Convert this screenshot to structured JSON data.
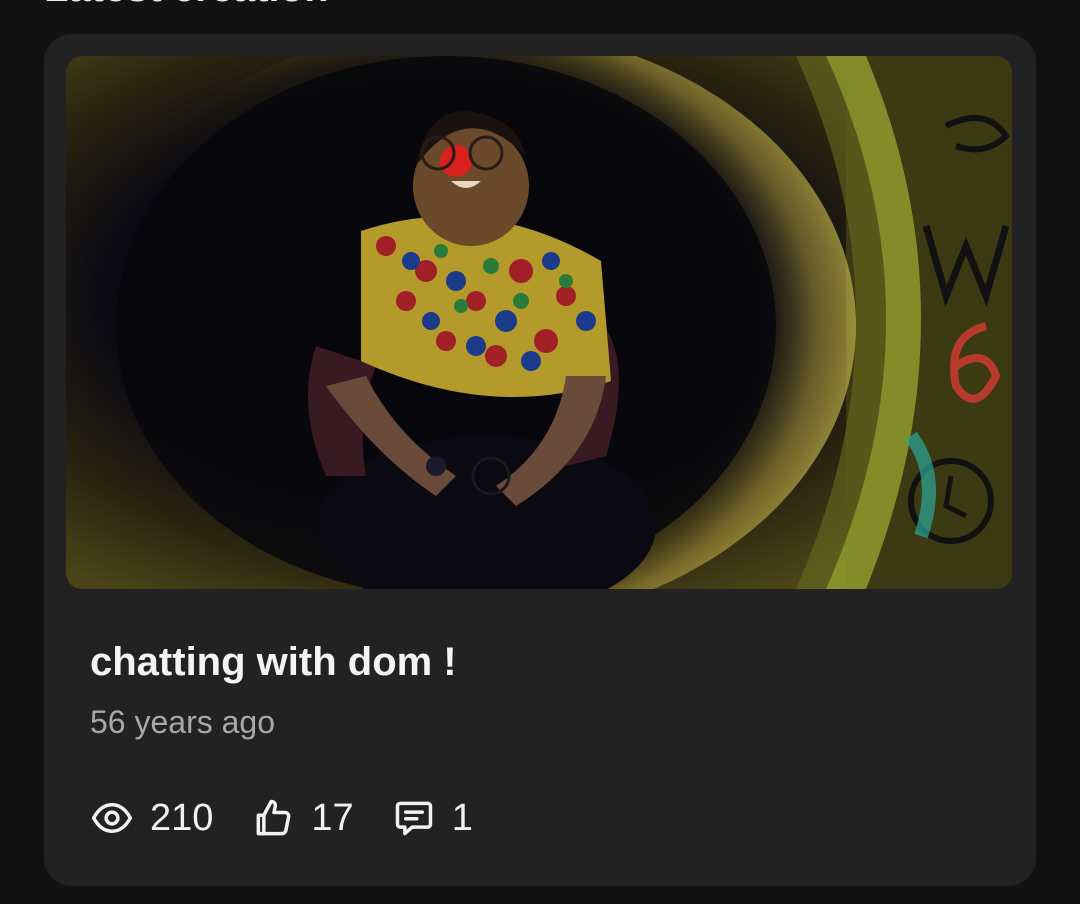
{
  "section": {
    "heading": "Latest creation"
  },
  "video": {
    "title": "chatting with dom !",
    "date": "56 years ago",
    "thumbnail_icon": "video-thumbnail-clown-in-tunnel",
    "stats": {
      "views": "210",
      "likes": "17",
      "comments": "1"
    },
    "icons": {
      "views": "eye-icon",
      "likes": "thumbs-up-icon",
      "comments": "comment-icon"
    }
  },
  "colors": {
    "page_background": "#121212",
    "card_background": "#222222",
    "title_text": "#f4f4f4",
    "secondary_text": "#a8a8a8"
  }
}
